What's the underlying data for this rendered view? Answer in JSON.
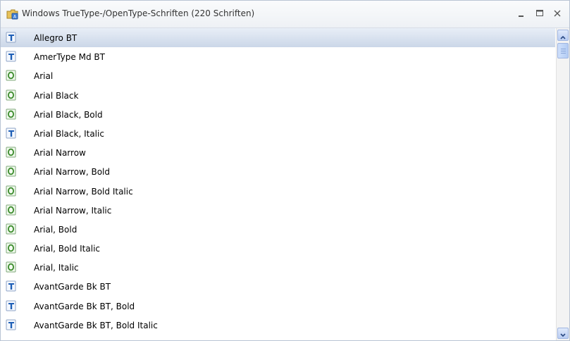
{
  "window": {
    "title": "Windows TrueType-/OpenType-Schriften (220 Schriften)",
    "icon": "fonts-folder-icon"
  },
  "controls": {
    "minimize_icon": "minimize-icon",
    "maximize_icon": "maximize-icon",
    "close_icon": "close-icon"
  },
  "colors": {
    "selected_row": "#cbd7e8",
    "truetype_icon": "#1f5fb6",
    "opentype_icon": "#3a8a2a"
  },
  "fonts": {
    "items": [
      {
        "label": "Allegro BT",
        "type": "truetype",
        "selected": true
      },
      {
        "label": "AmerType Md BT",
        "type": "truetype"
      },
      {
        "label": "Arial",
        "type": "opentype"
      },
      {
        "label": "Arial Black",
        "type": "opentype"
      },
      {
        "label": "Arial Black, Bold",
        "type": "opentype"
      },
      {
        "label": "Arial Black, Italic",
        "type": "truetype"
      },
      {
        "label": "Arial Narrow",
        "type": "opentype"
      },
      {
        "label": "Arial Narrow, Bold",
        "type": "opentype"
      },
      {
        "label": "Arial Narrow, Bold Italic",
        "type": "opentype"
      },
      {
        "label": "Arial Narrow, Italic",
        "type": "opentype"
      },
      {
        "label": "Arial, Bold",
        "type": "opentype"
      },
      {
        "label": "Arial, Bold Italic",
        "type": "opentype"
      },
      {
        "label": "Arial, Italic",
        "type": "opentype"
      },
      {
        "label": "AvantGarde Bk BT",
        "type": "truetype"
      },
      {
        "label": "AvantGarde Bk BT, Bold",
        "type": "truetype"
      },
      {
        "label": "AvantGarde Bk BT, Bold Italic",
        "type": "truetype"
      }
    ]
  }
}
